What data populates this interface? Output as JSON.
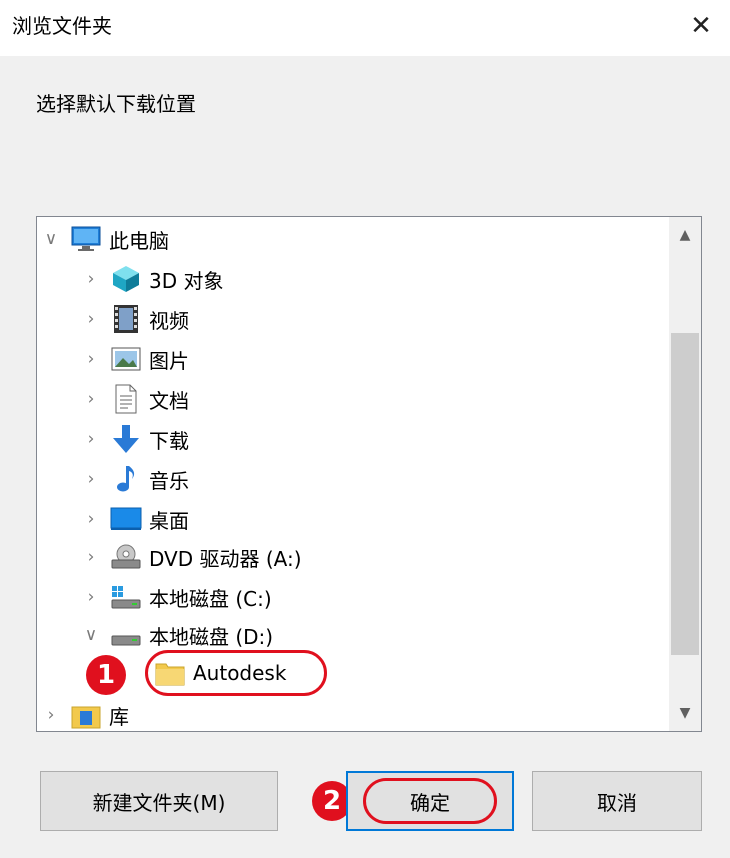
{
  "window": {
    "title": "浏览文件夹",
    "close_glyph": "✕"
  },
  "prompt": "选择默认下载位置",
  "tree": {
    "root": {
      "label": "此电脑",
      "icon": "monitor-icon"
    },
    "items": [
      {
        "label": "3D 对象",
        "icon": "cube-3d-icon"
      },
      {
        "label": "视频",
        "icon": "film-icon"
      },
      {
        "label": "图片",
        "icon": "picture-icon"
      },
      {
        "label": "文档",
        "icon": "document-icon"
      },
      {
        "label": "下载",
        "icon": "download-arrow-icon"
      },
      {
        "label": "音乐",
        "icon": "music-note-icon"
      },
      {
        "label": "桌面",
        "icon": "desktop-icon"
      },
      {
        "label": "DVD 驱动器 (A:)",
        "icon": "dvd-drive-icon"
      },
      {
        "label": "本地磁盘 (C:)",
        "icon": "system-drive-icon"
      },
      {
        "label": "本地磁盘 (D:)",
        "icon": "local-drive-icon"
      }
    ],
    "selected": {
      "label": "Autodesk",
      "icon": "folder-icon"
    },
    "library": {
      "label": "库",
      "icon": "library-icon"
    }
  },
  "buttons": {
    "new_folder": "新建文件夹(M)",
    "ok": "确定",
    "cancel": "取消"
  },
  "annotations": {
    "step1": "1",
    "step2": "2"
  },
  "colors": {
    "highlight": "#e0101e",
    "focus_border": "#0078d7",
    "window_bg": "#f0f0f0"
  }
}
